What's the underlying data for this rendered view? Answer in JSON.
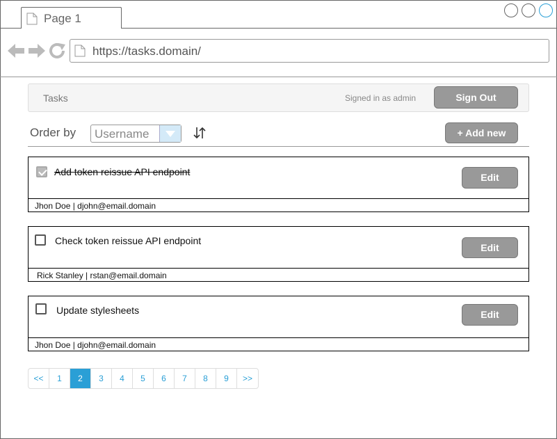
{
  "browser": {
    "tab_label": "Page 1",
    "url": "https://tasks.domain/"
  },
  "header": {
    "brand": "Tasks",
    "signed_in": "Signed in as admin",
    "sign_out_label": "Sign Out"
  },
  "toolbar": {
    "order_by_label": "Order by",
    "order_by_value": "Username",
    "add_new_label": "+ Add new"
  },
  "tasks": [
    {
      "title": "Add token reissue API endpoint",
      "done": true,
      "owner": "Jhon Doe | djohn@email.domain",
      "edit_label": "Edit"
    },
    {
      "title": "Check token reissue API endpoint",
      "done": false,
      "owner": "Rick Stanley | rstan@email.domain",
      "edit_label": "Edit"
    },
    {
      "title": "Update stylesheets",
      "done": false,
      "owner": "Jhon Doe | djohn@email.domain",
      "edit_label": "Edit"
    }
  ],
  "pagination": {
    "pages": [
      "<<",
      "1",
      "2",
      "3",
      "4",
      "5",
      "6",
      "7",
      "8",
      "9",
      ">>"
    ],
    "current": "2"
  },
  "icons": {
    "tab_doc": "document-icon",
    "back": "back-arrow-icon",
    "forward": "forward-arrow-icon",
    "reload": "reload-icon",
    "sort": "sort-icon",
    "dropdown": "chevron-down-icon"
  }
}
